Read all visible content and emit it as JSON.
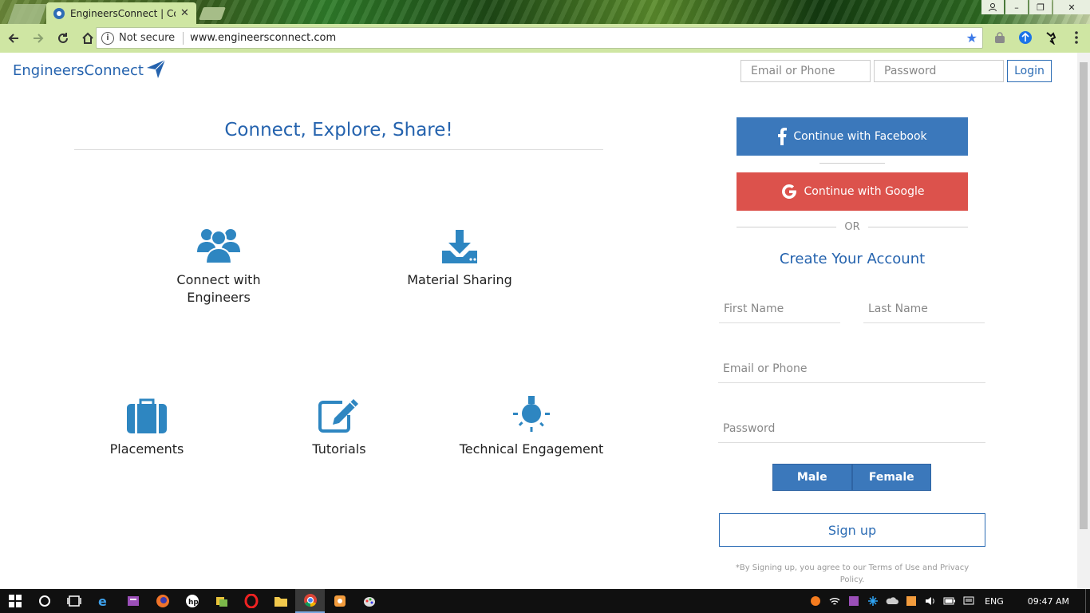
{
  "browser": {
    "tab_title": "EngineersConnect | Conn",
    "security_label": "Not secure",
    "url": "www.engineersconnect.com"
  },
  "header": {
    "logo_text": "EngineersConnect",
    "email_placeholder": "Email or Phone",
    "password_placeholder": "Password",
    "login_label": "Login"
  },
  "hero": {
    "tagline": "Connect, Explore, Share!",
    "features": [
      {
        "label": "Connect with Engineers",
        "icon": "users-icon"
      },
      {
        "label": "Material Sharing",
        "icon": "download-icon"
      },
      {
        "label": "Placements",
        "icon": "briefcase-icon"
      },
      {
        "label": "Tutorials",
        "icon": "edit-icon"
      },
      {
        "label": "Technical Engagement",
        "icon": "lightbulb-icon"
      }
    ]
  },
  "signup": {
    "facebook_label": "Continue with Facebook",
    "google_label": "Continue with Google",
    "or_label": "OR",
    "title": "Create Your Account",
    "first_name_placeholder": "First Name",
    "last_name_placeholder": "Last Name",
    "email_placeholder": "Email or Phone",
    "password_placeholder": "Password",
    "male_label": "Male",
    "female_label": "Female",
    "submit_label": "Sign up",
    "terms_text": "*By Signing up, you agree to our Terms of Use and Privacy Policy."
  },
  "taskbar": {
    "language": "ENG",
    "time": "09:47 AM"
  },
  "colors": {
    "brand_blue": "#2563ae",
    "facebook": "#3b78bb",
    "google": "#dc524c",
    "icon_blue": "#2e86c1"
  }
}
